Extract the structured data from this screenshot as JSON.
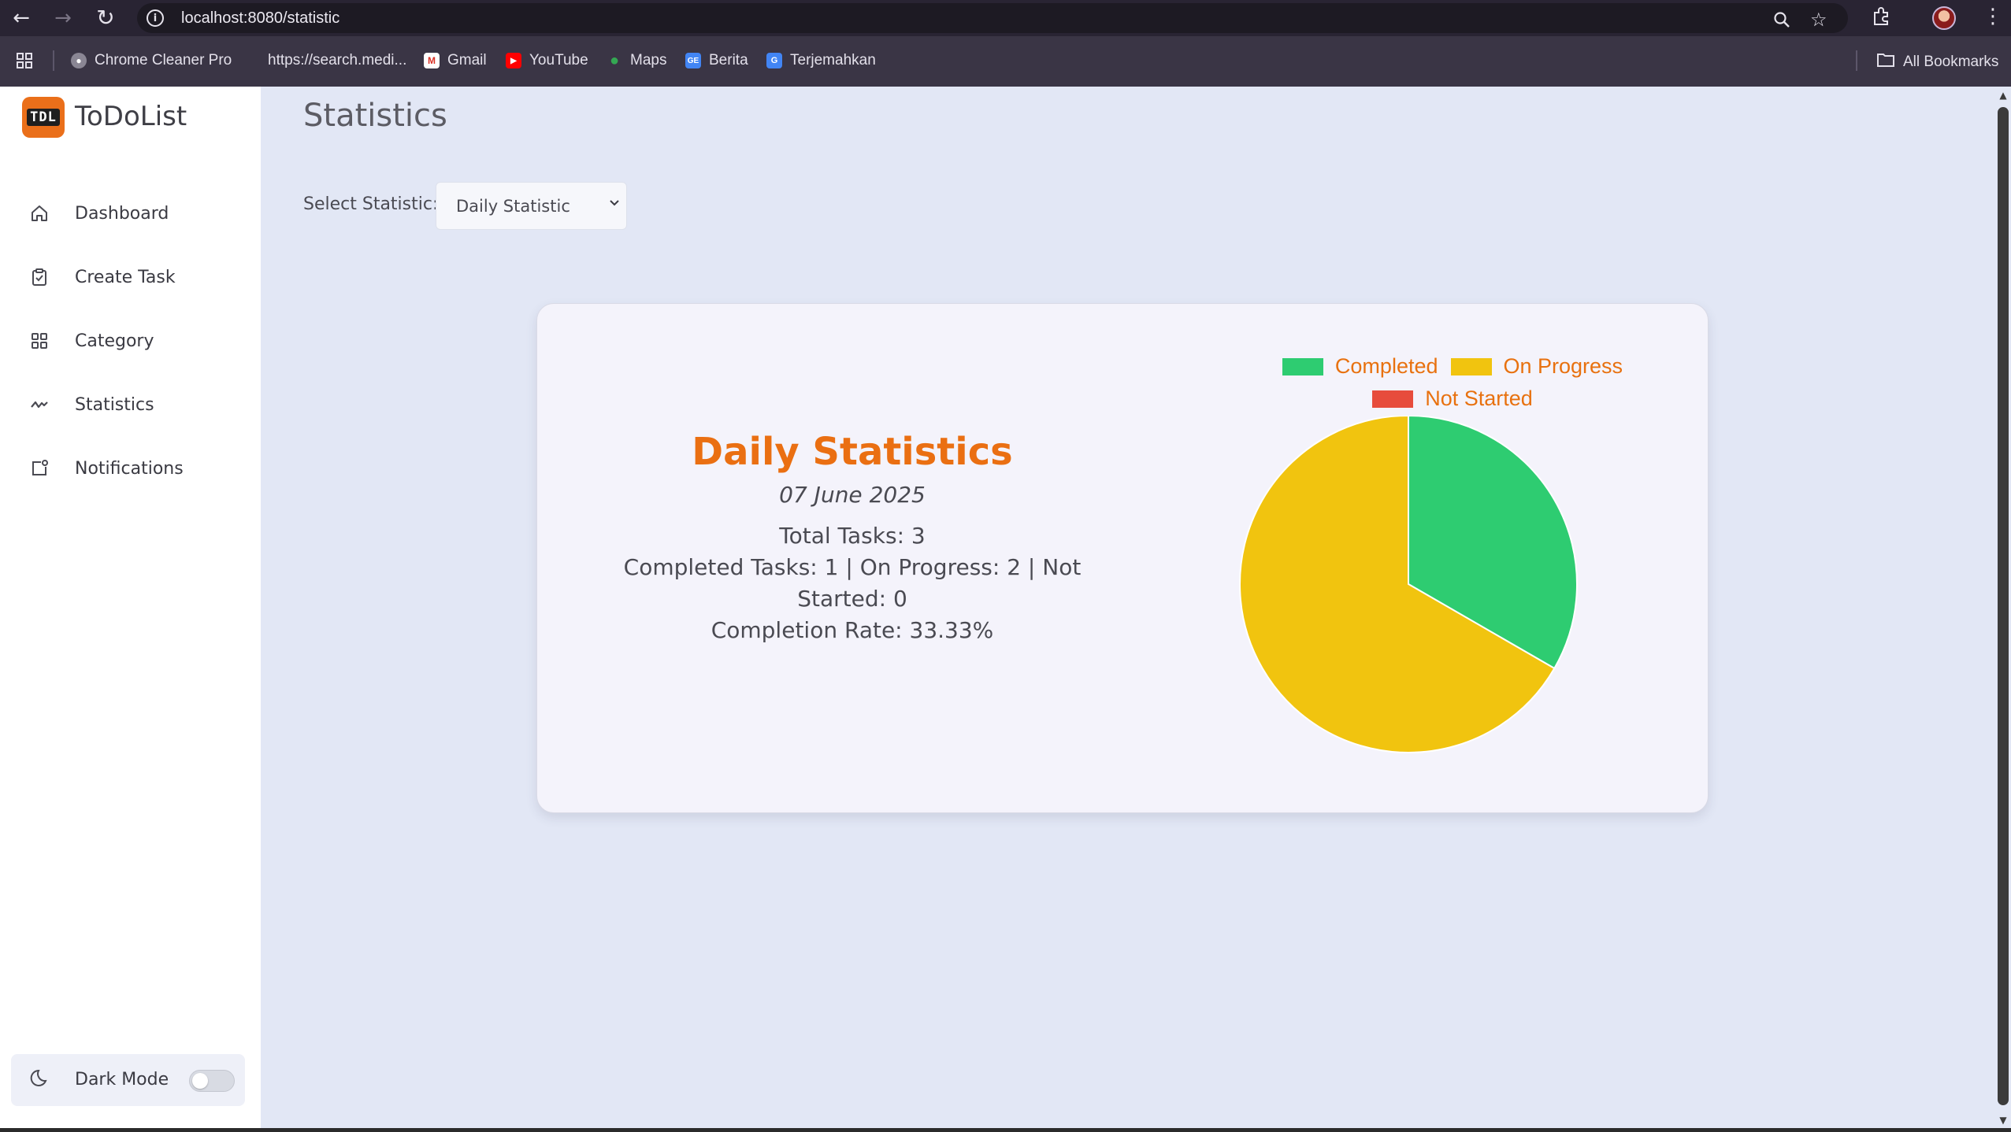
{
  "browser": {
    "url": "localhost:8080/statistic",
    "bookmarks": [
      {
        "label": "Chrome Cleaner Pro",
        "icon": "globe-icon"
      },
      {
        "label": "https://search.medi...",
        "icon": "none"
      },
      {
        "label": "Gmail",
        "icon": "gmail-icon"
      },
      {
        "label": "YouTube",
        "icon": "youtube-icon"
      },
      {
        "label": "Maps",
        "icon": "maps-icon"
      },
      {
        "label": "Berita",
        "icon": "news-icon"
      },
      {
        "label": "Terjemahkan",
        "icon": "translate-icon"
      }
    ],
    "all_bookmarks": "All Bookmarks"
  },
  "sidebar": {
    "logo_text": "TDL",
    "app_name": "ToDoList",
    "items": [
      {
        "label": "Dashboard",
        "icon": "home-icon"
      },
      {
        "label": "Create Task",
        "icon": "clipboard-check-icon"
      },
      {
        "label": "Category",
        "icon": "grid-icon"
      },
      {
        "label": "Statistics",
        "icon": "activity-icon"
      },
      {
        "label": "Notifications",
        "icon": "notification-icon"
      }
    ],
    "dark_mode_label": "Dark Mode",
    "dark_mode_on": false
  },
  "main": {
    "title": "Statistics",
    "select_label": "Select Statistic:",
    "select_value": "Daily Statistic"
  },
  "card": {
    "title": "Daily Statistics",
    "date": "07 June 2025",
    "total": "Total Tasks: 3",
    "breakdown": "Completed Tasks: 1 | On Progress: 2 | Not Started: 0",
    "rate": "Completion Rate: 33.33%"
  },
  "chart_data": {
    "type": "pie",
    "categories": [
      "Completed",
      "On Progress",
      "Not Started"
    ],
    "values": [
      1,
      2,
      0
    ],
    "colors": [
      "#2ecc71",
      "#f1c40f",
      "#e74c3c"
    ],
    "legend_position": "top",
    "legend_text_color": "#e8710f"
  },
  "colors": {
    "accent": "#ea6f12",
    "background": "#e2e7f5",
    "sidebar": "#ffffff",
    "card": "#f4f3fb"
  }
}
